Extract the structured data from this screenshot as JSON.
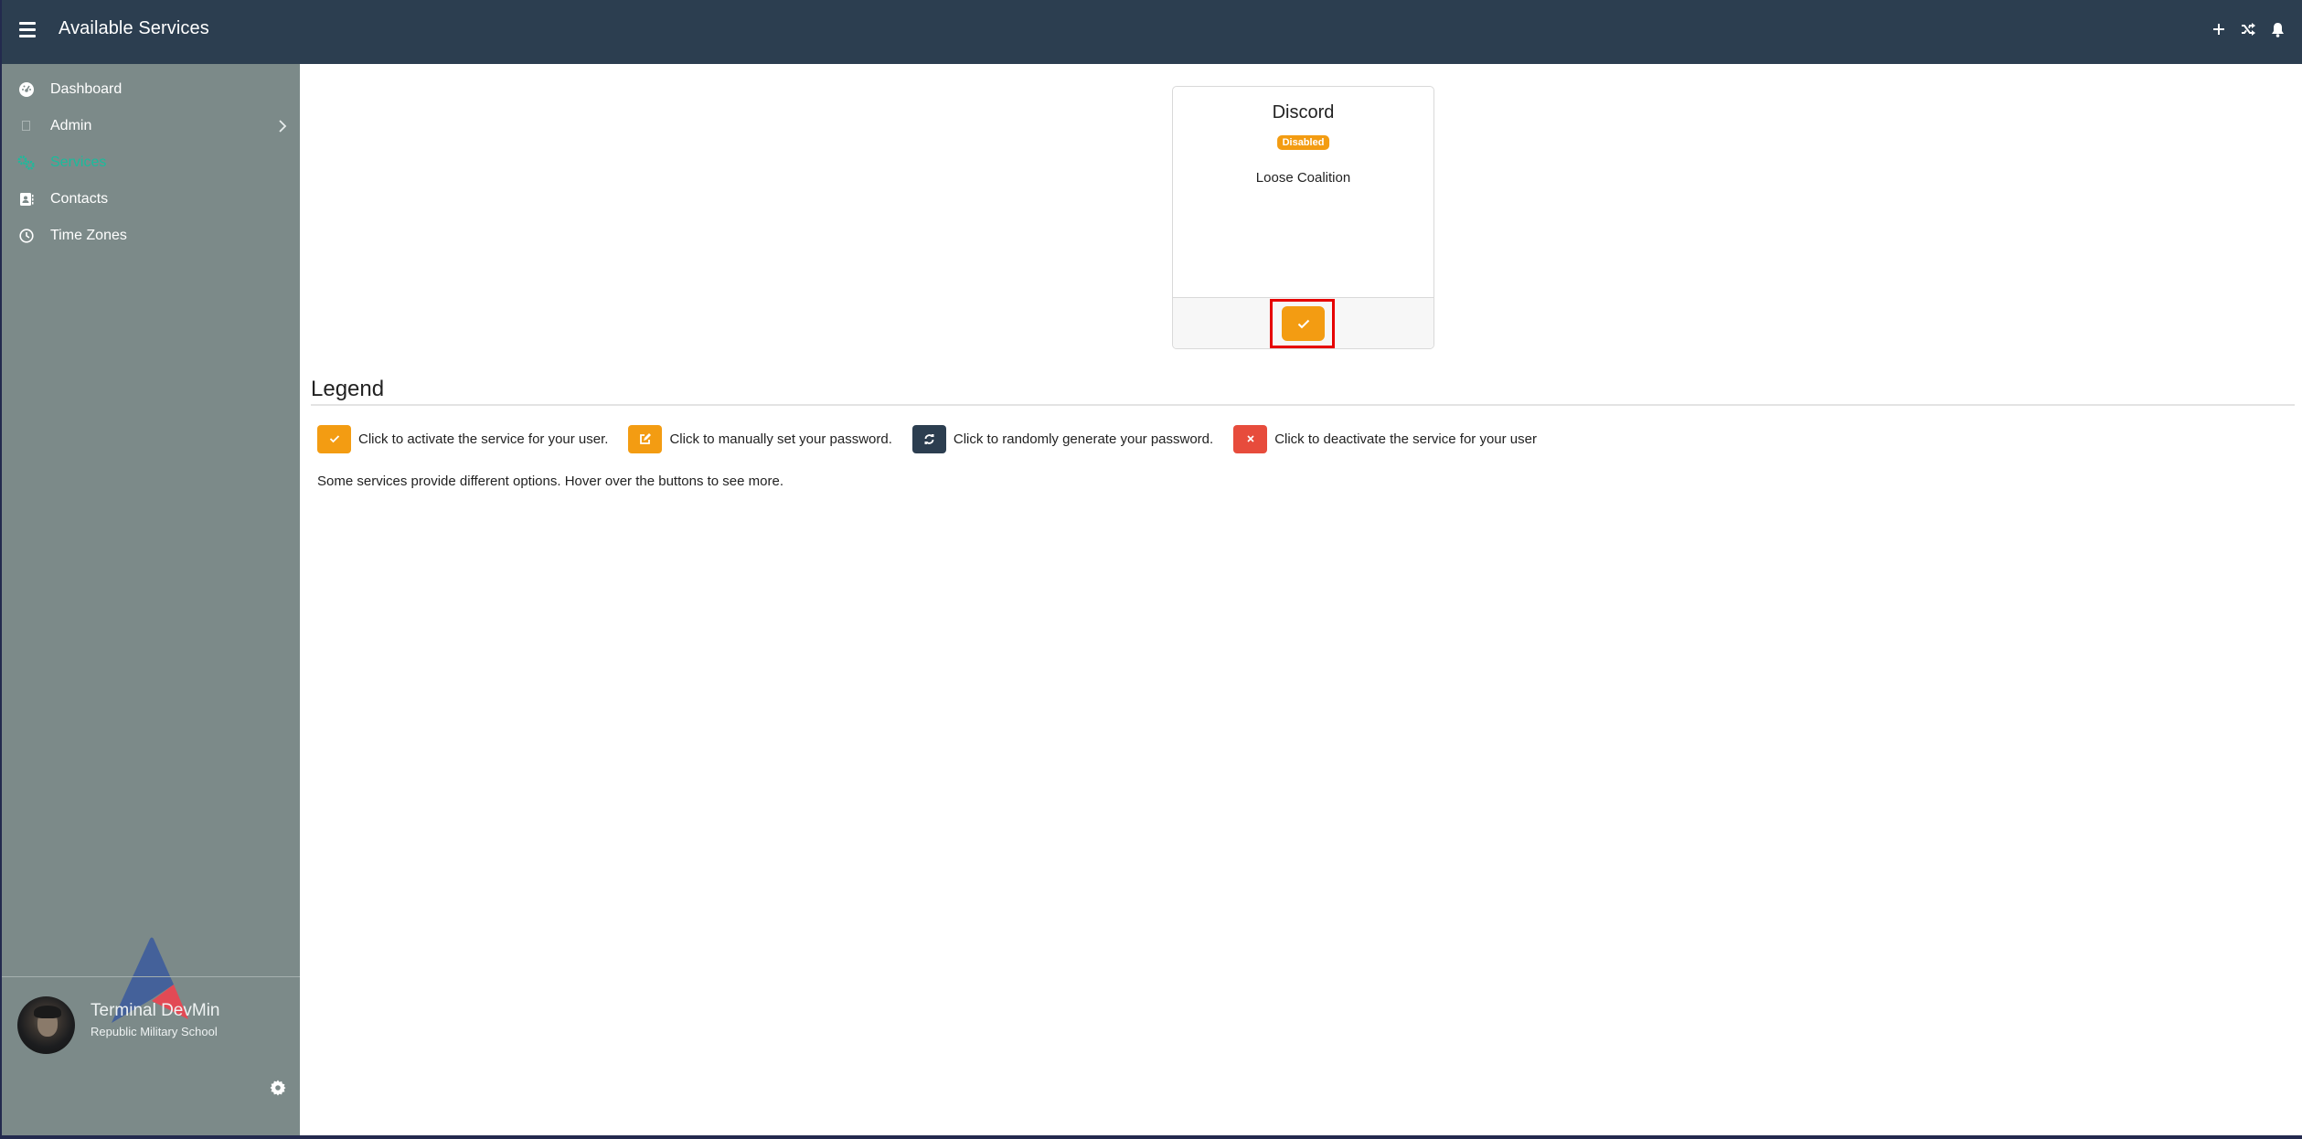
{
  "header": {
    "title": "Available Services",
    "actions": [
      {
        "icon": "plus-icon",
        "glyph": "+"
      },
      {
        "icon": "shuffle-icon"
      },
      {
        "icon": "bell-icon"
      }
    ]
  },
  "sidebar": {
    "items": [
      {
        "label": "Dashboard",
        "icon": "dashboard-gauge-icon"
      },
      {
        "label": "Admin",
        "icon": "admin-placeholder-icon",
        "has_submenu": true
      },
      {
        "label": "Services",
        "icon": "cogs-icon",
        "active": true
      },
      {
        "label": "Contacts",
        "icon": "address-book-icon"
      },
      {
        "label": "Time Zones",
        "icon": "clock-icon"
      }
    ],
    "user": {
      "name": "Terminal DevMin",
      "organization": "Republic Military School"
    }
  },
  "services": [
    {
      "name": "Discord",
      "status": "Disabled",
      "group": "Loose Coalition",
      "action": "activate"
    }
  ],
  "legend": {
    "title": "Legend",
    "items": [
      {
        "icon": "check-icon",
        "color": "#f39c12",
        "text": "Click to activate the service for your user."
      },
      {
        "icon": "edit-icon",
        "color": "#f39c12",
        "text": "Click to manually set your password."
      },
      {
        "icon": "refresh-icon",
        "color": "#2c3e50",
        "text": "Click to randomly generate your password."
      },
      {
        "icon": "close-icon",
        "color": "#e74c3c",
        "text": "Click to deactivate the service for your user"
      }
    ],
    "note": "Some services provide different options. Hover over the buttons to see more."
  },
  "colors": {
    "topbar": "#2c3e50",
    "sidebar": "#7c8a89",
    "active": "#1abc9c",
    "warning": "#f39c12",
    "danger": "#e74c3c",
    "dark": "#2c3e50",
    "focus_outline": "#e60000"
  }
}
